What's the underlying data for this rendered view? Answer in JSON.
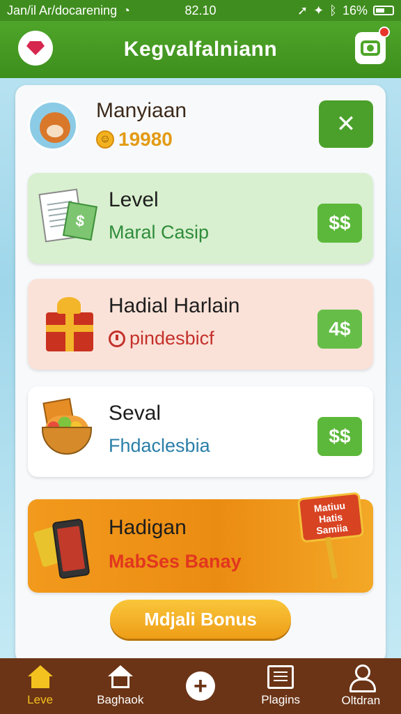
{
  "status_bar": {
    "carrier": "Jan/il Ar/docarening",
    "time": "82.10",
    "battery": "16%"
  },
  "header": {
    "title": "Kegvalfalniann"
  },
  "profile": {
    "name": "Manyiaan",
    "coins": "19980",
    "close_label": "✕"
  },
  "cards": [
    {
      "title": "Level",
      "subtitle": "Maral Casip",
      "action": "$$"
    },
    {
      "title": "Hadial Harlain",
      "subtitle": "pindesbicf",
      "action": "4$"
    },
    {
      "title": "Seval",
      "subtitle": "Fhdaclesbia",
      "action": "$$"
    },
    {
      "title": "Hadigan",
      "subtitle": "MabSes Banay",
      "sign_line1": "Matiuu",
      "sign_line2": "Hatis",
      "sign_line3": "Samiia"
    }
  ],
  "bonus_button": "Mdjali Bonus",
  "nav": [
    {
      "label": "Leve"
    },
    {
      "label": "Baghaok"
    },
    {
      "label": ""
    },
    {
      "label": "Plagins"
    },
    {
      "label": "Oltdran"
    }
  ],
  "colors": {
    "header_green": "#3d8f1c",
    "nav_brown": "#6b3416",
    "active_yellow": "#f4c21f"
  }
}
